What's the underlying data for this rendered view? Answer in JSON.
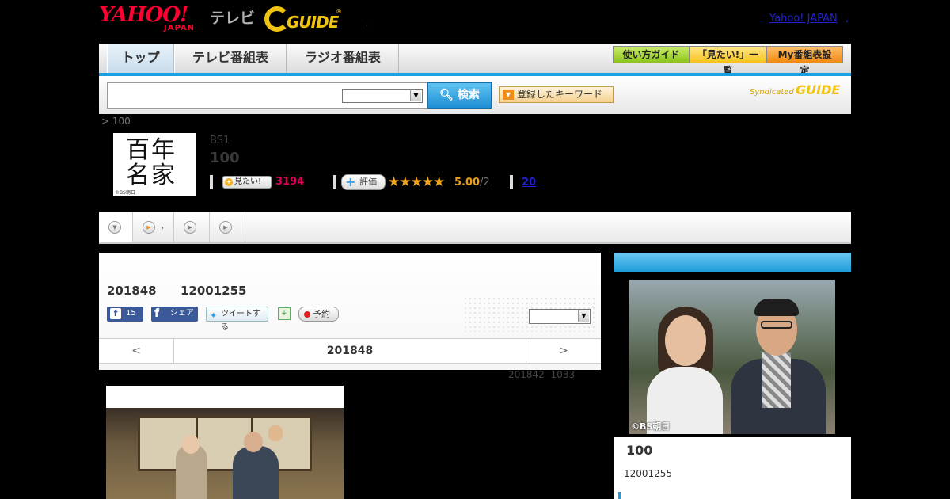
{
  "header": {
    "yahoo_logo": "YAHOO!",
    "japan_logo": "JAPAN",
    "tv_label": "テレビ",
    "gguide_logo": "GUIDE",
    "gguide_reg": "®",
    "dot": ",",
    "yahoo_japan_link": "Yahoo! JAPAN",
    "link_sep": ","
  },
  "nav": {
    "tabs": [
      {
        "label": "トップ"
      },
      {
        "label": "テレビ番組表"
      },
      {
        "label": "ラジオ番組表"
      }
    ],
    "buttons": [
      {
        "label": "使い方ガイド"
      },
      {
        "label": "「見たい!」一覧"
      },
      {
        "label": "My番組表設定"
      }
    ]
  },
  "search": {
    "placeholder": "",
    "button_label": "検索",
    "keyword_button": "登録したキーワード",
    "syndicated": "Syndicated",
    "gguide_small": "GUIDE"
  },
  "breadcrumb": "> 100",
  "program": {
    "thumb_chars": "百年名家",
    "thumb_credit": "©BS朝日",
    "channel": "BS1",
    "title": "100",
    "mitai_label": "見たい!",
    "mitai_count": "3194",
    "hyoka_label": "評価",
    "stars": "★★★★★",
    "score": "5.00",
    "score_count": "/2",
    "review_link": "20"
  },
  "subtabs": {
    "s1_dot": ","
  },
  "broadcast": {
    "date": "201848",
    "time": "12001255",
    "fb_like_count": "15",
    "fb_share": "シェア",
    "tweet": "ツイートする",
    "reserve": "予約",
    "pager_prev": "<",
    "pager_current": "201848",
    "pager_next": ">",
    "updated": "201842 1033"
  },
  "sidebar": {
    "photo_credit": "©BS朝日",
    "title": "100",
    "time": "12001255"
  }
}
